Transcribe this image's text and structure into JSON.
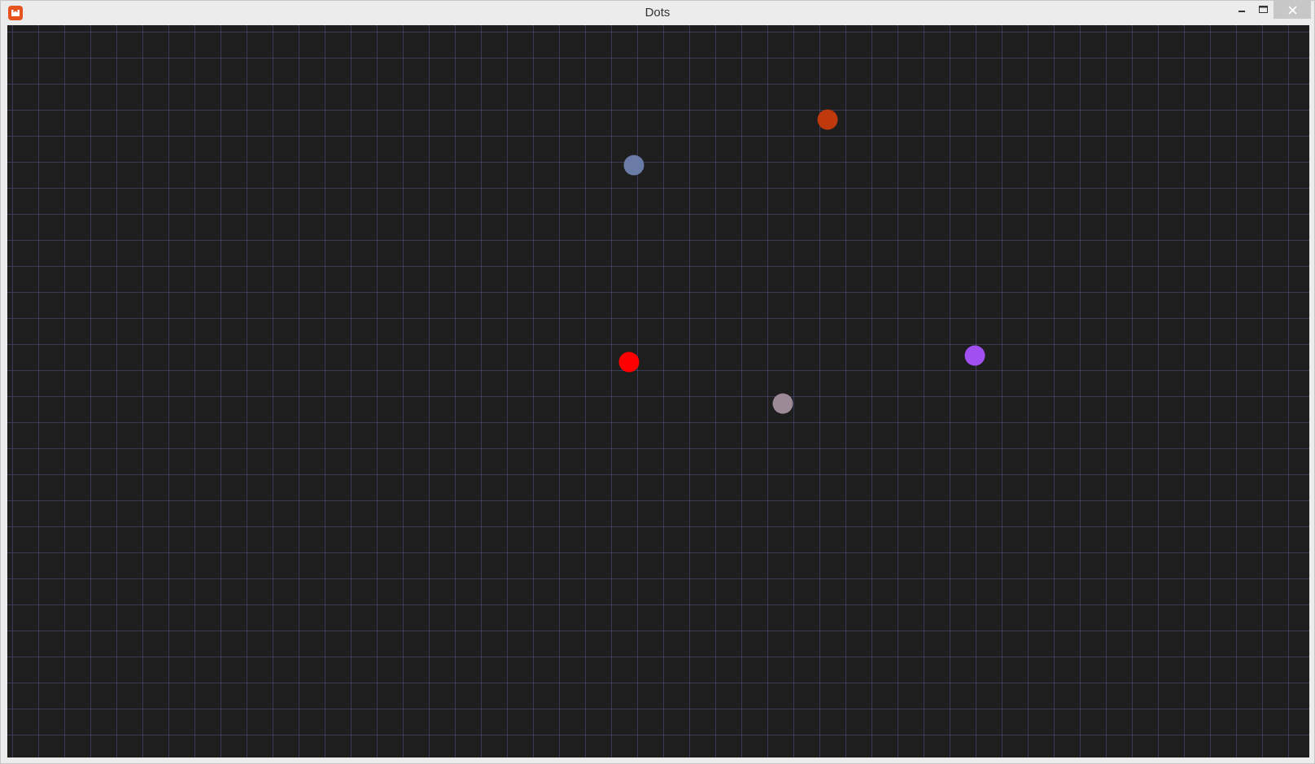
{
  "window": {
    "title": "Dots",
    "icon": "monogame-logo-icon",
    "controls": {
      "minimize_icon": "minimize-icon",
      "maximize_icon": "maximize-icon",
      "close_icon": "close-icon"
    },
    "colors": {
      "titlebar": "#ececec",
      "close_button": "#c7c7c7",
      "logo": "#e7531f"
    }
  },
  "game": {
    "background_color": "#1e1e1e",
    "grid_color": "#524e82",
    "dots": [
      {
        "color": "#6a7ba8"
      },
      {
        "color": "#c0390c"
      },
      {
        "color": "#ff0000"
      },
      {
        "color": "#9c8a98"
      },
      {
        "color": "#a050f0"
      }
    ]
  }
}
